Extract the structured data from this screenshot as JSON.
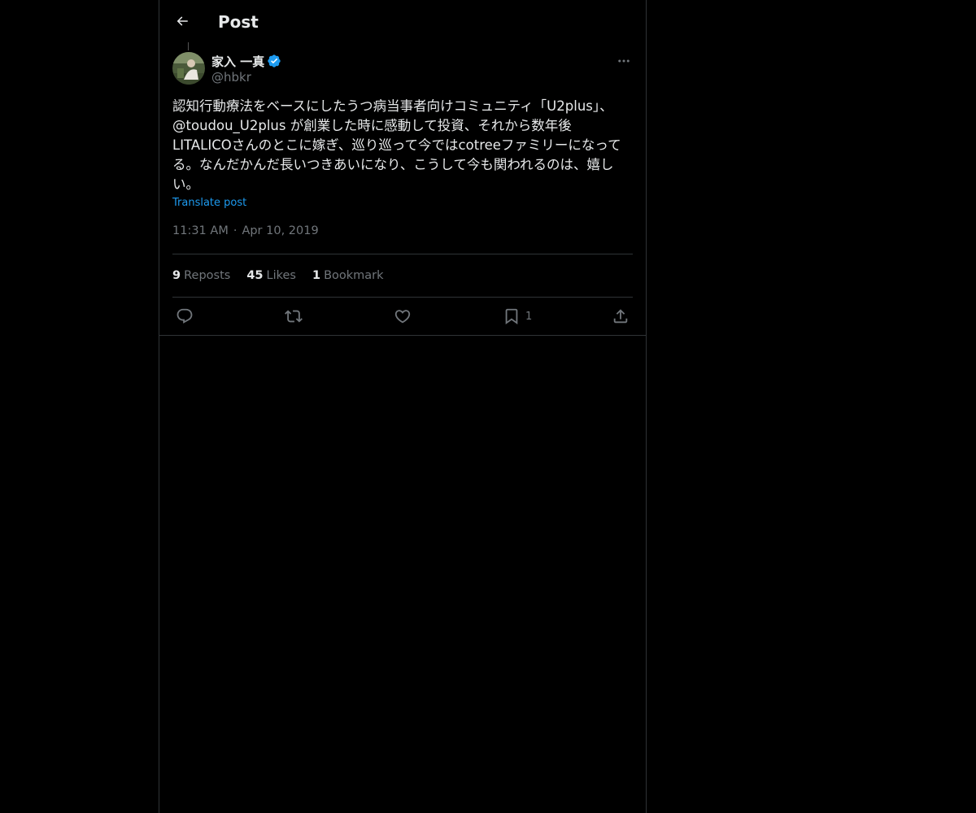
{
  "header": {
    "back_icon": "arrow-left-icon",
    "title": "Post"
  },
  "post": {
    "author": {
      "name": "家入 一真",
      "handle": "@hbkr",
      "verified": true,
      "verified_color": "#1d9bf0"
    },
    "text": "認知行動療法をベースにしたうつ病当事者向けコミュニティ「U2plus」、\n@toudou_U2plus が創業した時に感動して投資、それから数年後\nLITALICOさんのとこに嫁ぎ、巡り巡って今ではcotreeファミリーになって\nる。なんだかんだ長いつきあいになり、こうして今も関われるのは、嬉し\nい。",
    "translate_label": "Translate post",
    "time": "11:31 AM",
    "separator": "·",
    "date": "Apr 10, 2019"
  },
  "stats": {
    "reposts": {
      "count": "9",
      "label": "Reposts"
    },
    "likes": {
      "count": "45",
      "label": "Likes"
    },
    "bookmarks": {
      "count": "1",
      "label": "Bookmark"
    }
  },
  "actions": {
    "reply_icon": "reply-icon",
    "repost_icon": "repost-icon",
    "like_icon": "heart-icon",
    "bookmark_icon": "bookmark-icon",
    "bookmark_count": "1",
    "share_icon": "share-icon"
  },
  "colors": {
    "background": "#000000",
    "text": "#e7e9ea",
    "muted": "#71767b",
    "accent": "#1d9bf0",
    "border": "#2f3336"
  }
}
